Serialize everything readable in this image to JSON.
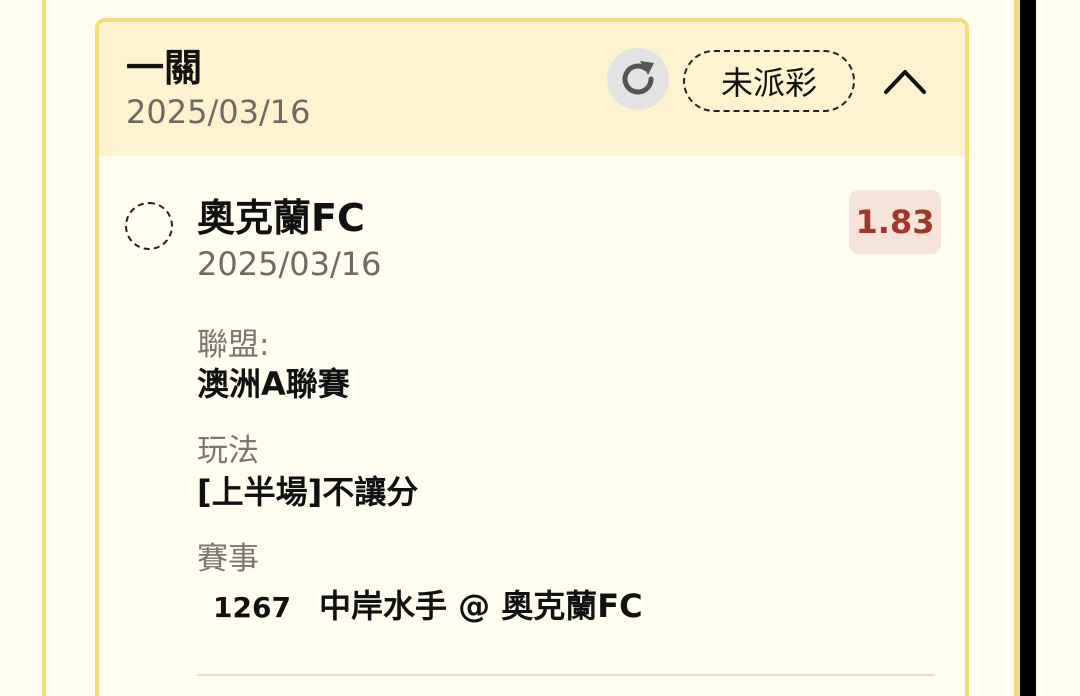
{
  "header": {
    "bet_type": "一關",
    "date": "2025/03/16",
    "refresh_icon": "refresh-icon",
    "status": "未派彩",
    "collapse_icon": "chevron-up-icon"
  },
  "selection": {
    "team": "奧克蘭FC",
    "date": "2025/03/16",
    "odds": "1.83"
  },
  "fields": {
    "league_label": "聯盟:",
    "league_value": "澳洲A聯賽",
    "play_label": "玩法",
    "play_value": "[上半場]不讓分",
    "event_label": "賽事",
    "event_no": "1267",
    "event_match": "中岸水手 @ 奧克蘭FC"
  },
  "colors": {
    "header_bg": "#fdf4cf",
    "border": "#f1df75",
    "odds_text": "#a0392b",
    "odds_bg": "#f6e3da"
  }
}
